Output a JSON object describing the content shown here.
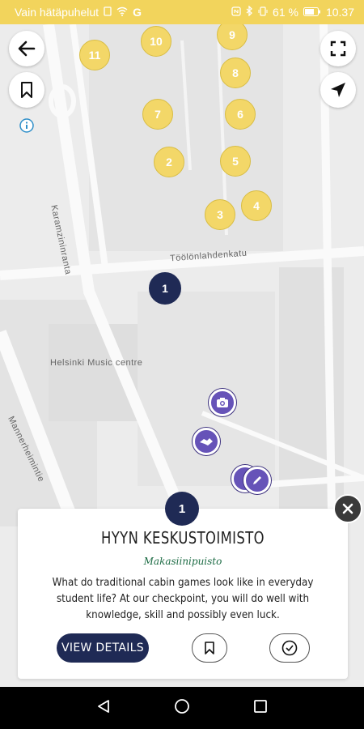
{
  "status_bar": {
    "carrier_text": "Vain hätäpuhelut",
    "network_g": "G",
    "battery_percent": "61 %",
    "time": "10.37"
  },
  "map": {
    "streets": [
      "Karamzininranta",
      "Töölönlahdenkatu",
      "Helsinki Music centre",
      "Mannerheimintie"
    ],
    "yellow_pins": [
      "11",
      "10",
      "9",
      "8",
      "7",
      "6",
      "2",
      "5",
      "4",
      "3"
    ],
    "dark_pin": "1",
    "purple_pins": [
      "camera-icon",
      "handshake-icon",
      "pencil-icon"
    ]
  },
  "controls": {
    "back": "back-arrow-icon",
    "bookmark": "bookmark-icon",
    "info": "info-icon",
    "fullscreen": "fullscreen-icon",
    "locate": "navigation-arrow-icon"
  },
  "card": {
    "pin_number": "1",
    "title": "HYYN KESKUSTOIMISTO",
    "subtitle": "Makasiinipuisto",
    "description": "What do traditional cabin games look like in everyday student life? At our checkpoint, you will do well with knowledge, skill and possibly even luck.",
    "view_details_label": "VIEW DETAILS"
  },
  "colors": {
    "status_bar": "#f2d45c",
    "yellow_pin": "#f3d768",
    "dark_navy": "#1f2a55",
    "purple": "#6653b8",
    "subtitle_green": "#1c6b44"
  }
}
